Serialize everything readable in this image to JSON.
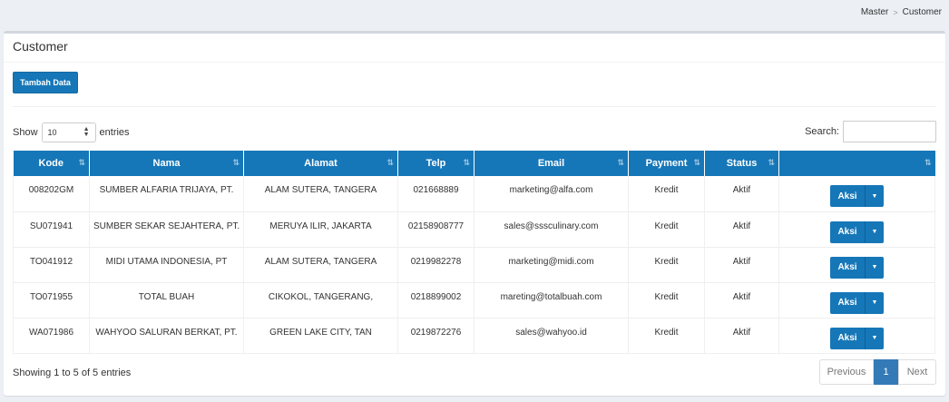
{
  "breadcrumb": {
    "items": [
      "Master",
      "Customer"
    ],
    "separator": ">"
  },
  "box": {
    "title": "Customer",
    "add_button": "Tambah Data"
  },
  "length_control": {
    "show": "Show",
    "value": "10",
    "entries": "entries"
  },
  "search": {
    "label": "Search:",
    "value": ""
  },
  "table": {
    "columns": [
      "Kode",
      "Nama",
      "Alamat",
      "Telp",
      "Email",
      "Payment",
      "Status",
      ""
    ],
    "sort_icon": "⇅",
    "rows": [
      {
        "kode": "008202GM",
        "nama": "SUMBER ALFARIA TRIJAYA, PT.",
        "alamat": "ALAM SUTERA, TANGERA",
        "telp": "021668889",
        "email": "marketing@alfa.com",
        "payment": "Kredit",
        "status": "Aktif",
        "aksi": "Aksi"
      },
      {
        "kode": "SU071941",
        "nama": "SUMBER SEKAR SEJAHTERA, PT.",
        "alamat": "MERUYA ILIR, JAKARTA",
        "telp": "02158908777",
        "email": "sales@sssculinary.com",
        "payment": "Kredit",
        "status": "Aktif",
        "aksi": "Aksi"
      },
      {
        "kode": "TO041912",
        "nama": "MIDI UTAMA INDONESIA, PT",
        "alamat": "ALAM SUTERA, TANGERA",
        "telp": "0219982278",
        "email": "marketing@midi.com",
        "payment": "Kredit",
        "status": "Aktif",
        "aksi": "Aksi"
      },
      {
        "kode": "TO071955",
        "nama": "TOTAL BUAH",
        "alamat": "CIKOKOL, TANGERANG,",
        "telp": "0218899002",
        "email": "mareting@totalbuah.com",
        "payment": "Kredit",
        "status": "Aktif",
        "aksi": "Aksi"
      },
      {
        "kode": "WA071986",
        "nama": "WAHYOO SALURAN BERKAT, PT.",
        "alamat": "GREEN LAKE CITY, TAN",
        "telp": "0219872276",
        "email": "sales@wahyoo.id",
        "payment": "Kredit",
        "status": "Aktif",
        "aksi": "Aksi"
      }
    ]
  },
  "info": "Showing 1 to 5 of 5 entries",
  "pagination": {
    "previous": "Previous",
    "current": "1",
    "next": "Next"
  },
  "colors": {
    "primary": "#1677b8",
    "page_bg": "#ecf0f5",
    "pager_active": "#337ab7"
  }
}
